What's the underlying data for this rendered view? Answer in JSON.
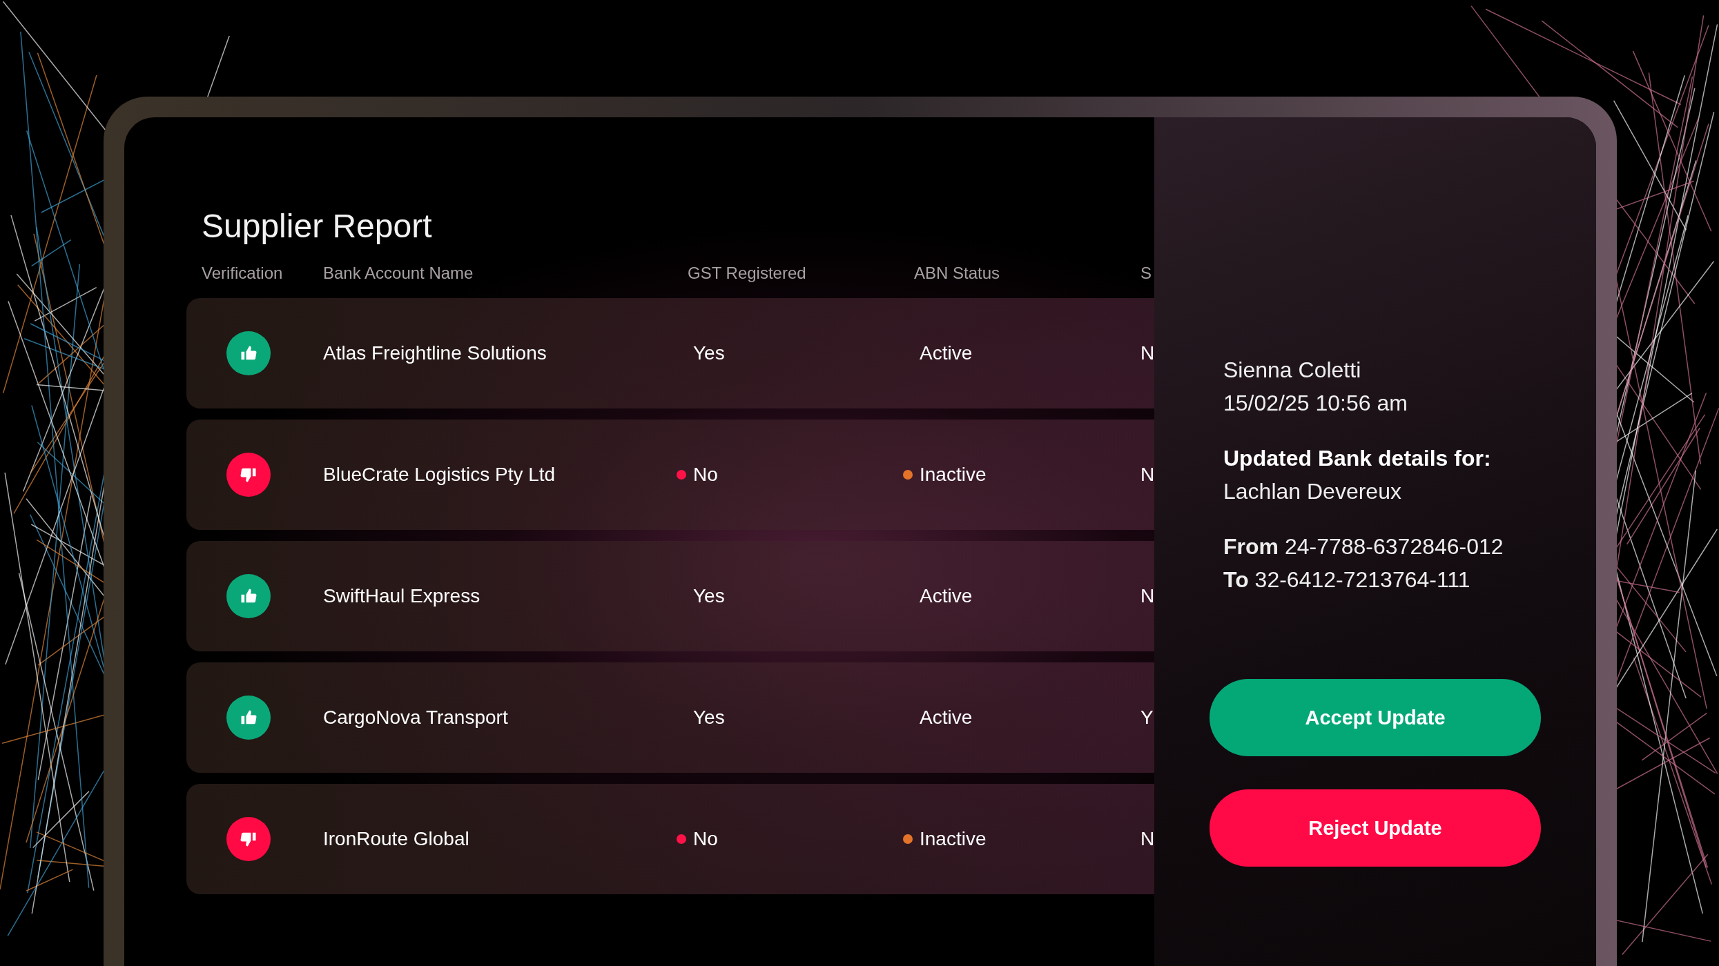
{
  "report": {
    "title": "Supplier Report",
    "columns": [
      "Verification",
      "Bank Account Name",
      "GST Registered",
      "ABN Status",
      "S"
    ],
    "rows": [
      {
        "verified": true,
        "name": "Atlas Freightline Solutions",
        "gst": {
          "text": "Yes"
        },
        "abn": {
          "text": "Active"
        },
        "column_5": "N"
      },
      {
        "verified": false,
        "name": "BlueCrate Logistics Pty Ltd",
        "gst": {
          "text": "No",
          "color": "#ff1248"
        },
        "abn": {
          "text": "Inactive",
          "color": "#e4732a"
        },
        "column_5": "N"
      },
      {
        "verified": true,
        "name": "SwiftHaul Express",
        "gst": {
          "text": "Yes"
        },
        "abn": {
          "text": "Active"
        },
        "column_5": "N"
      },
      {
        "verified": true,
        "name": "CargoNova Transport",
        "gst": {
          "text": "Yes"
        },
        "abn": {
          "text": "Active"
        },
        "column_5": "Y"
      },
      {
        "verified": false,
        "name": "IronRoute Global",
        "gst": {
          "text": "No",
          "color": "#ff1248"
        },
        "abn": {
          "text": "Inactive",
          "color": "#e4732a"
        },
        "column_5": "N"
      }
    ]
  },
  "update_panel": {
    "author": "Sienna Coletti",
    "timestamp": "15/02/25 10:56 am",
    "heading": "Updated Bank details for:",
    "supplier": "Lachlan Devereux",
    "from": "**From** 24-7788-6372846-012",
    "to": "**To** 32-6412-7213764-111",
    "buttons": [
      {
        "label": "Accept Update",
        "kind": "accept"
      },
      {
        "label": "Reject Update",
        "kind": "reject"
      }
    ]
  }
}
